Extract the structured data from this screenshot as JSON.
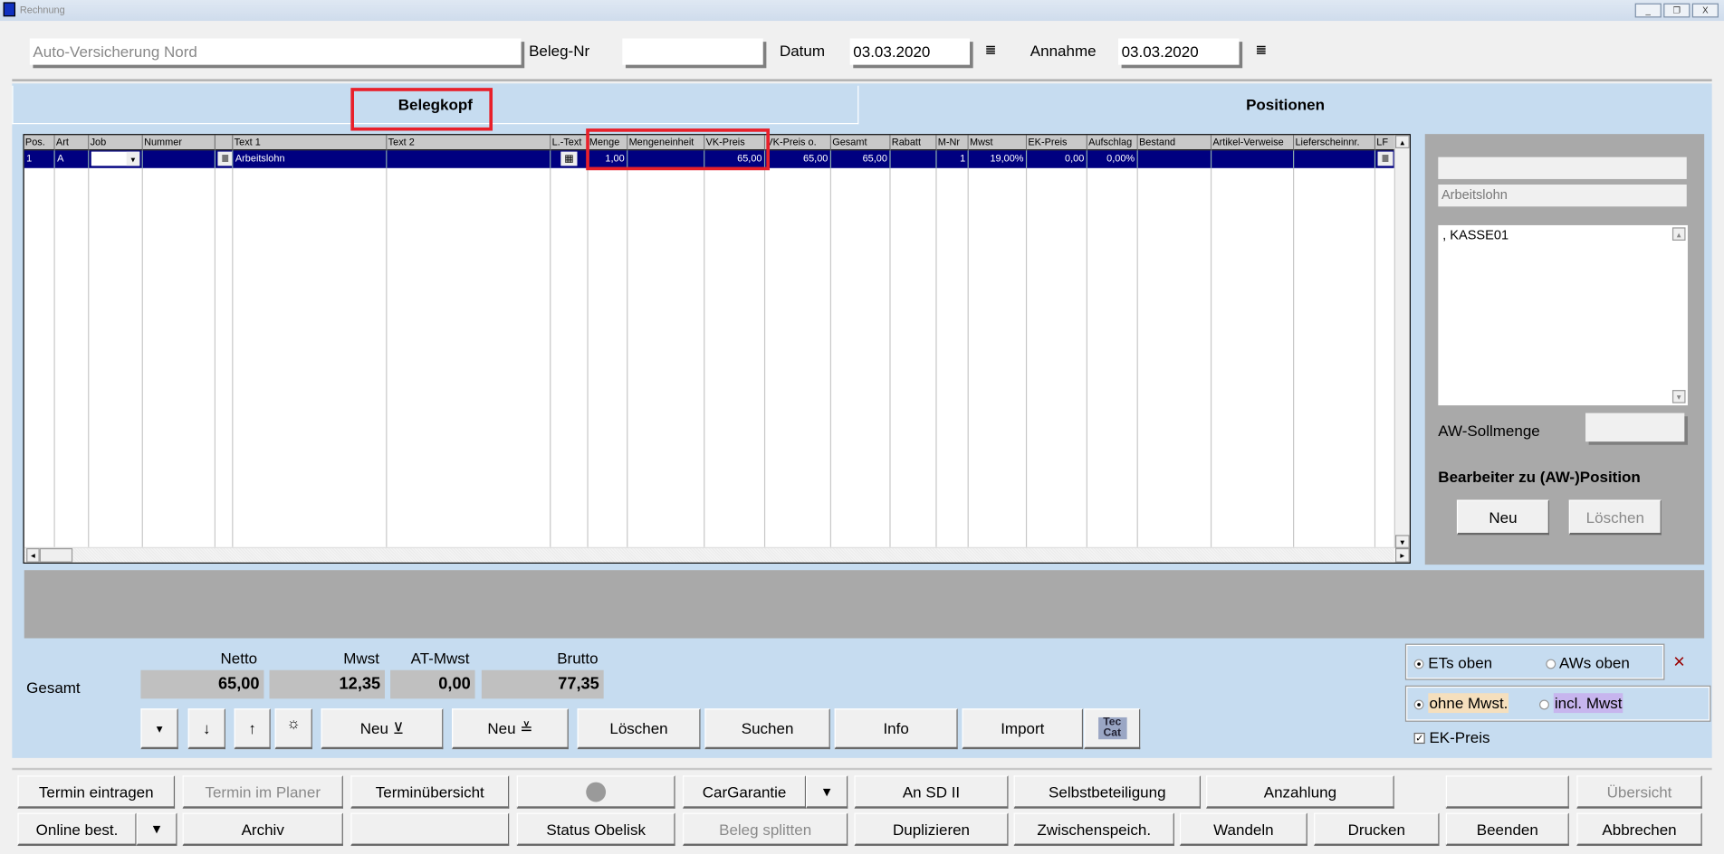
{
  "window": {
    "title": "Rechnung",
    "minimize": "_",
    "restore": "❐",
    "close": "X"
  },
  "header": {
    "customer": "Auto-Versicherung Nord",
    "beleg_nr_label": "Beleg-Nr",
    "beleg_nr": "",
    "datum_label": "Datum",
    "datum": "03.03.2020",
    "annahme_label": "Annahme",
    "annahme": "03.03.2020",
    "calendar_icon": "≣"
  },
  "tabs": [
    {
      "label": "Belegkopf",
      "highlighted": true
    },
    {
      "label": "Positionen"
    }
  ],
  "grid": {
    "columns": [
      "Pos.",
      "Art",
      "Job",
      "Nummer",
      "",
      "Text 1",
      "Text 2",
      "L.-Text",
      "Menge",
      "Mengeneinheit",
      "VK-Preis",
      "VK-Preis o.",
      "Gesamt",
      "Rabatt",
      "M-Nr",
      "Mwst",
      "EK-Preis",
      "Aufschlag",
      "Bestand",
      "Artikel-Verweise",
      "Lieferscheinnr.",
      "LF"
    ],
    "rows": [
      [
        "1",
        "A",
        "",
        "",
        "≣",
        "Arbeitslohn",
        "",
        "▦",
        "1,00",
        "",
        "65,00",
        "65,00",
        "65,00",
        "",
        "1",
        "19,00%",
        "0,00",
        "0,00%",
        "",
        "",
        "",
        "≣"
      ]
    ],
    "highlight_columns": [
      "Menge",
      "Mengeneinheit",
      "VK-Preis"
    ],
    "selected_row_color": "#000080"
  },
  "side": {
    "field1": "",
    "field2": "Arbeitslohn",
    "notes": ", KASSE01",
    "aw_label": "AW-Sollmenge",
    "aw_value": "",
    "bearbeiter_label": "Bearbeiter zu (AW-)Position",
    "new": "Neu",
    "delete": "Löschen"
  },
  "totals": {
    "row_label": "Gesamt",
    "netto_label": "Netto",
    "netto": "65,00",
    "mwst_label": "Mwst",
    "mwst": "12,35",
    "atmwst_label": "AT-Mwst",
    "atmwst": "0,00",
    "brutto_label": "Brutto",
    "brutto": "77,35"
  },
  "actions": {
    "dropdown": "▾",
    "down": "↓",
    "up": "↑",
    "gear": "☼",
    "new_below": "Neu ⊻",
    "new_between": "Neu ≚",
    "delete": "Löschen",
    "search": "Suchen",
    "info": "Info",
    "import": "Import",
    "teccat": "Tec Cat"
  },
  "options": {
    "ets": "ETs oben",
    "aws": "AWs oben",
    "ets_selected": true,
    "close": "×",
    "ohne": "ohne Mwst.",
    "incl": "incl. Mwst",
    "ohne_selected": true,
    "ohne_color": "#f5dfbd",
    "incl_color": "#c7b5ee",
    "ek_preis": "EK-Preis",
    "ek_checked": true
  },
  "bottom": {
    "row1": [
      {
        "label": "Termin eintragen"
      },
      {
        "label": "Termin im Planer",
        "disabled": true
      },
      {
        "label": "Terminübersicht"
      },
      {
        "label": ""
      },
      {
        "label": "CarGarantie"
      },
      {
        "label": "▾"
      },
      {
        "label": "An SD II"
      },
      {
        "label": "Selbstbeteiligung"
      },
      {
        "label": "Anzahlung"
      },
      {
        "label": ""
      },
      {
        "label": "Übersicht",
        "disabled": true
      }
    ],
    "row2": [
      {
        "label": "Online best."
      },
      {
        "label": "▾"
      },
      {
        "label": "Archiv"
      },
      {
        "label": ""
      },
      {
        "label": "Status Obelisk"
      },
      {
        "label": "Beleg splitten",
        "disabled": true
      },
      {
        "label": "Duplizieren"
      },
      {
        "label": "Zwischenspeich."
      },
      {
        "label": "Wandeln"
      },
      {
        "label": "Drucken"
      },
      {
        "label": "Beenden"
      },
      {
        "label": "Abbrechen"
      }
    ]
  }
}
